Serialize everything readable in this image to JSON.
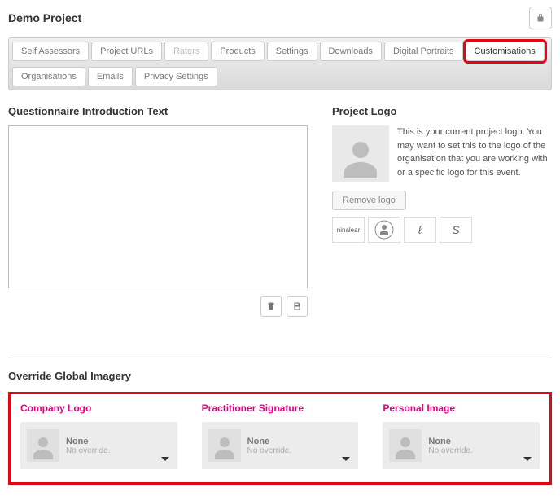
{
  "header": {
    "title": "Demo Project"
  },
  "tabs": [
    "Self Assessors",
    "Project URLs",
    "Raters",
    "Products",
    "Settings",
    "Downloads",
    "Digital Portraits",
    "Customisations",
    "Organisations",
    "Emails",
    "Privacy Settings"
  ],
  "activeTab": "Customisations",
  "disabledTab": "Raters",
  "intro": {
    "title": "Questionnaire Introduction Text",
    "value": ""
  },
  "projectLogo": {
    "title": "Project Logo",
    "desc": "This is your current project logo. You may want to set this to the logo of the organisation that you are working with or a specific logo for this event.",
    "removeLabel": "Remove logo"
  },
  "thumbs": {
    "t1": "ninalear"
  },
  "overrideHeading": "Override Global Imagery",
  "overrides": [
    {
      "title": "Company Logo",
      "name": "None",
      "sub": "No override."
    },
    {
      "title": "Practitioner Signature",
      "name": "None",
      "sub": "No override."
    },
    {
      "title": "Personal Image",
      "name": "None",
      "sub": "No override."
    }
  ]
}
